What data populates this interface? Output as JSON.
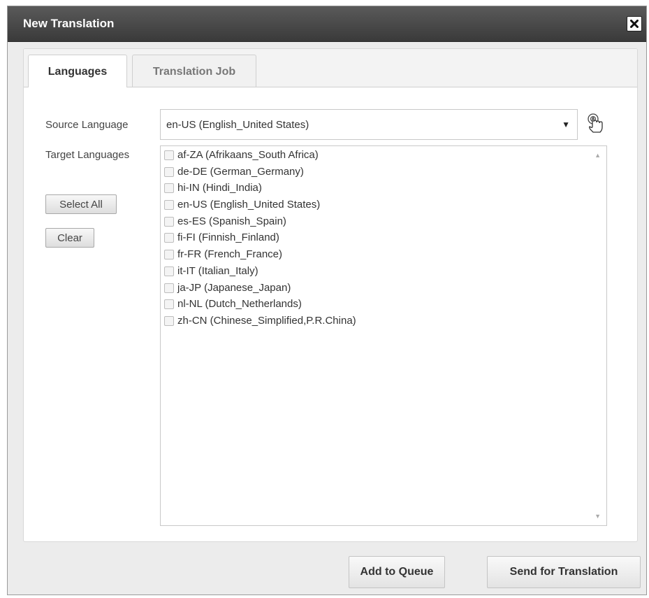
{
  "dialog": {
    "title": "New Translation",
    "close_icon": "close-icon"
  },
  "tabs": [
    {
      "label": "Languages",
      "active": true
    },
    {
      "label": "Translation Job",
      "active": false
    }
  ],
  "form": {
    "source_label": "Source Language",
    "source_value": "en-US  (English_United States)",
    "target_label": "Target Languages",
    "select_all_label": "Select All",
    "clear_label": "Clear",
    "help_icon": "pointer-hand-icon"
  },
  "languages": [
    {
      "code": "af-ZA",
      "text": "af-ZA  (Afrikaans_South Africa)",
      "checked": false
    },
    {
      "code": "de-DE",
      "text": "de-DE  (German_Germany)",
      "checked": false
    },
    {
      "code": "hi-IN",
      "text": "hi-IN  (Hindi_India)",
      "checked": false
    },
    {
      "code": "en-US",
      "text": "en-US  (English_United States)",
      "checked": false
    },
    {
      "code": "es-ES",
      "text": "es-ES  (Spanish_Spain)",
      "checked": false
    },
    {
      "code": "fi-FI",
      "text": "fi-FI  (Finnish_Finland)",
      "checked": false
    },
    {
      "code": "fr-FR",
      "text": "fr-FR  (French_France)",
      "checked": false
    },
    {
      "code": "it-IT",
      "text": "it-IT  (Italian_Italy)",
      "checked": false
    },
    {
      "code": "ja-JP",
      "text": "ja-JP  (Japanese_Japan)",
      "checked": false
    },
    {
      "code": "nl-NL",
      "text": "nl-NL  (Dutch_Netherlands)",
      "checked": false
    },
    {
      "code": "zh-CN",
      "text": "zh-CN  (Chinese_Simplified,P.R.China)",
      "checked": false
    }
  ],
  "footer": {
    "add_to_queue_label": "Add to Queue",
    "send_label": "Send for Translation"
  },
  "colors": {
    "titlebar": "#3f3f3f",
    "dialog_bg": "#ececec",
    "panel_bg": "#ffffff"
  }
}
